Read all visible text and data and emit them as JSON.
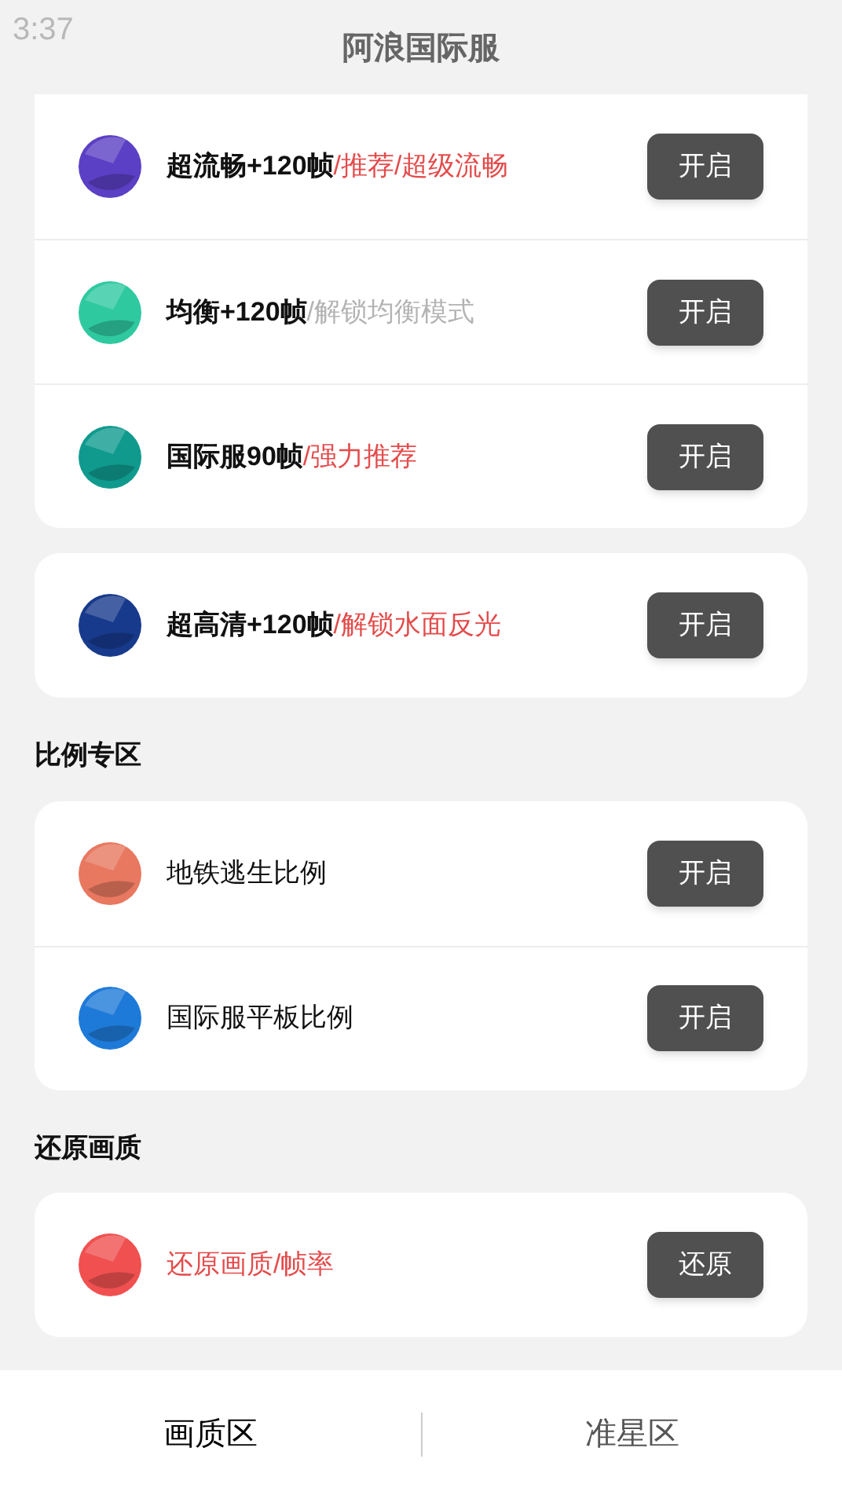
{
  "status_bar": {
    "time": "3:37"
  },
  "header": {
    "title": "阿浪国际服"
  },
  "sections": [
    {
      "cards": [
        {
          "items": [
            {
              "parts": [
                {
                  "text": "超流畅+120帧",
                  "color": "#111111"
                },
                {
                  "text": "/推荐/超级流畅",
                  "color": "#e44b4b"
                }
              ],
              "bold": true,
              "color": "#5b3fc4",
              "button": "开启"
            },
            {
              "parts": [
                {
                  "text": "均衡+120帧",
                  "color": "#111111"
                },
                {
                  "text": "/解锁均衡模式",
                  "color": "#b3b3b3"
                }
              ],
              "bold": true,
              "color": "#2fc9a0",
              "button": "开启"
            },
            {
              "parts": [
                {
                  "text": "国际服90帧",
                  "color": "#111111"
                },
                {
                  "text": "/强力推荐",
                  "color": "#e44b4b"
                }
              ],
              "bold": true,
              "color": "#109a8e",
              "button": "开启"
            }
          ]
        },
        {
          "items": [
            {
              "parts": [
                {
                  "text": "超高清+120帧",
                  "color": "#111111"
                },
                {
                  "text": "/解锁水面反光",
                  "color": "#e44b4b"
                }
              ],
              "bold": true,
              "color": "#183a8c",
              "button": "开启"
            }
          ]
        }
      ]
    },
    {
      "heading": "比例专区",
      "cards": [
        {
          "items": [
            {
              "parts": [
                {
                  "text": "地铁逃生比例",
                  "color": "#111111"
                }
              ],
              "bold": false,
              "color": "#e87860",
              "button": "开启"
            },
            {
              "parts": [
                {
                  "text": "国际服平板比例",
                  "color": "#111111"
                }
              ],
              "bold": false,
              "color": "#1e7ad8",
              "button": "开启"
            }
          ]
        }
      ]
    },
    {
      "heading": "还原画质",
      "cards": [
        {
          "items": [
            {
              "parts": [
                {
                  "text": "还原画质/帧率",
                  "color": "#e44b4b"
                }
              ],
              "bold": false,
              "color": "#f05050",
              "button": "还原"
            }
          ]
        }
      ]
    }
  ],
  "bottom_nav": [
    {
      "label": "画质区",
      "selected": true
    },
    {
      "label": "准星区",
      "selected": false
    }
  ]
}
